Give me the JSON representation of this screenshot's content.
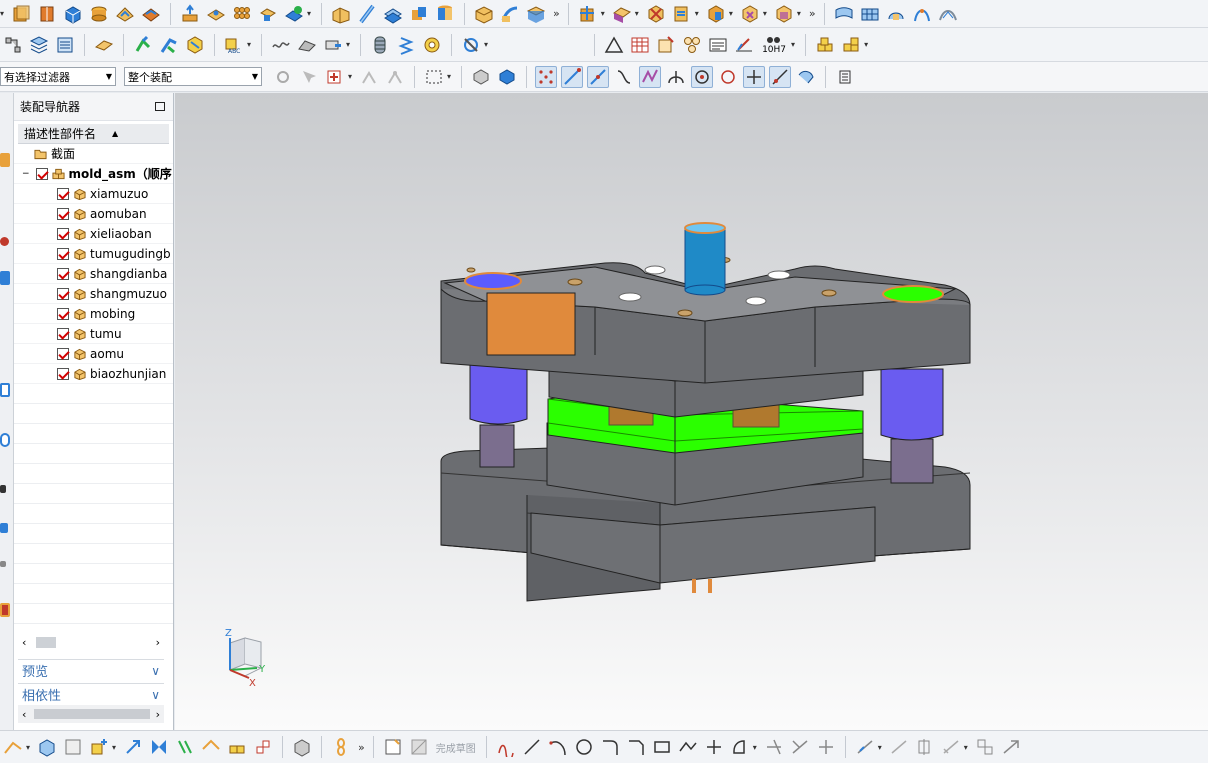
{
  "toolbar": {
    "row1_icons": [
      "extrude-icon",
      "revolve-icon",
      "block-icon",
      "cylinder-icon",
      "cone-icon",
      "sphere-icon",
      "hole-icon",
      "boss-icon",
      "pocket-icon",
      "pad-icon",
      "slot-icon",
      "groove-icon",
      "pattern-icon",
      "unite-icon",
      "subtract-icon",
      "intersect-icon",
      "trim-body-icon",
      "split-body-icon",
      "offset-face-icon",
      "sweep-icon",
      "tube-icon",
      "shell-icon",
      "blend-icon",
      "chamfer-icon",
      "draft-icon",
      "mirror-icon",
      "surface-icon",
      "mesh-surface-icon",
      "ruled-icon",
      "curve-icon",
      "bridge-icon"
    ],
    "row2_icons": [
      "assembly-icon",
      "layer-icon",
      "part-navigator-icon",
      "measure-icon",
      "constraint-icon",
      "move-component-icon",
      "explode-icon",
      "wave-icon",
      "spring-icon",
      "bolt-icon",
      "washer-icon",
      "thread-icon",
      "triangle-icon",
      "table-icon",
      "dimension-icon",
      "weld-icon",
      "note-icon",
      "tolerance-icon"
    ],
    "tolerance_label": "10H7",
    "filter_select": "有选择过滤器",
    "scope_select": "整个装配"
  },
  "navigator": {
    "title": "装配导航器",
    "column_header": "描述性部件名",
    "section_folder": "截面",
    "root": "mold_asm（顺序",
    "items": [
      {
        "label": "xiamuzuo"
      },
      {
        "label": "aomuban"
      },
      {
        "label": "xieliaoban"
      },
      {
        "label": "tumugudingb"
      },
      {
        "label": "shangdianba"
      },
      {
        "label": "shangmuzuo"
      },
      {
        "label": "mobing"
      },
      {
        "label": "tumu"
      },
      {
        "label": "aomu"
      },
      {
        "label": "biaozhunjian"
      }
    ],
    "preview_label": "预览",
    "dependency_label": "相依性"
  },
  "triad": {
    "z": "Z",
    "y": "Y",
    "x": "X"
  },
  "bottombar": {
    "finish_sketch": "完成草图"
  },
  "colors": {
    "plate_grey": "#6c6e72",
    "pin_blue": "#6a5cf0",
    "punch_green": "#2bff00",
    "guide_blue": "#1f8ac7",
    "insert_orange": "#e08a3c",
    "accent": "#3a6fb0"
  }
}
